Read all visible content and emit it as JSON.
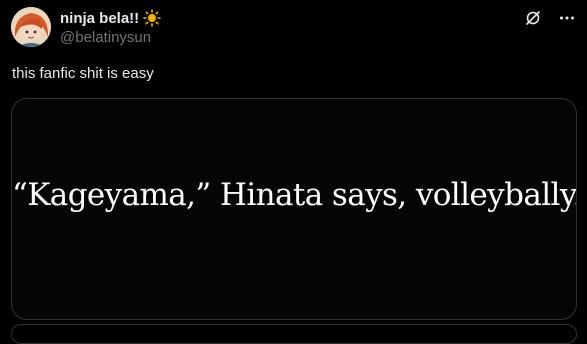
{
  "tweet": {
    "author": {
      "display_name": "ninja bela!!",
      "handle": "@belatinysun",
      "name_emoji": "sun-icon"
    },
    "text": "this fanfic shit is easy",
    "media": {
      "quote": "“Kageyama,” Hinata says, volleybally."
    }
  },
  "actions": {
    "grok_icon": "slashed-circle-icon",
    "more_icon": "more-dots-icon"
  },
  "colors": {
    "background": "#000000",
    "text_primary": "#e7e9ea",
    "text_secondary": "#71767b",
    "border": "#2f3336"
  }
}
